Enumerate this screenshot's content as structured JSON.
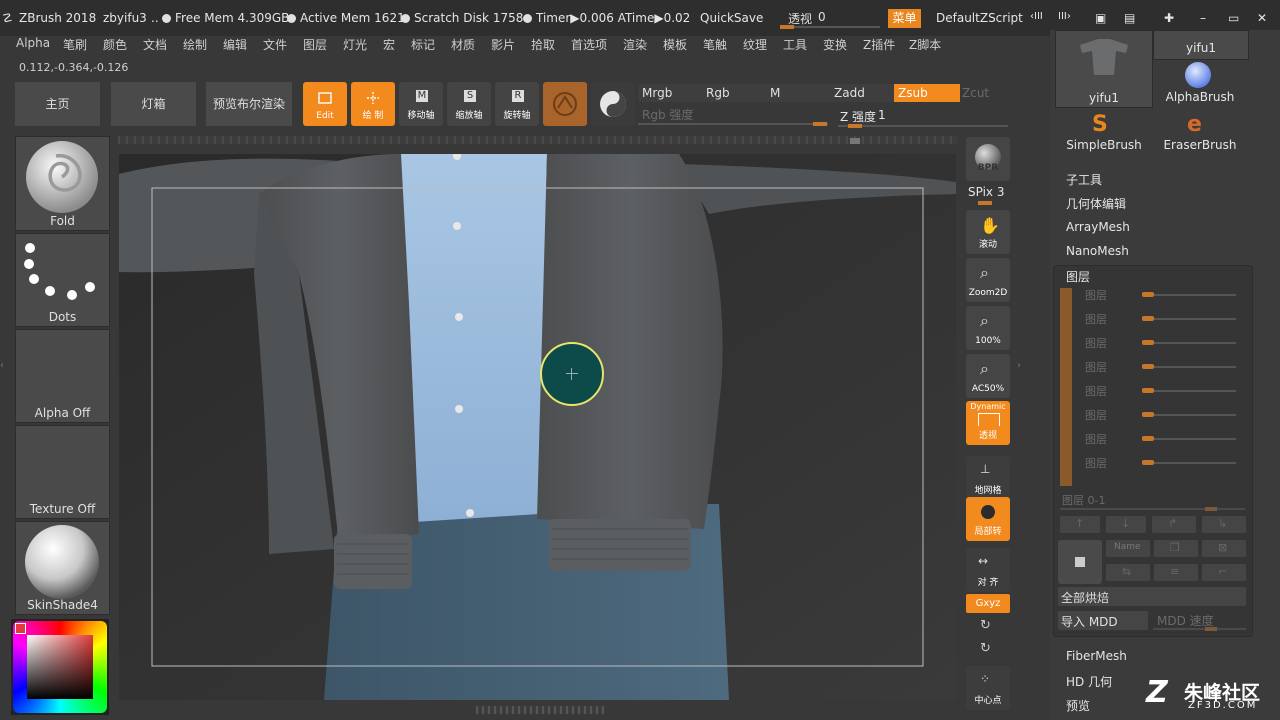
{
  "titlebar": {
    "app": "ZBrush 2018",
    "doc": "zbyifu3",
    "dots": "..",
    "free_mem": "Free Mem 4.309GB",
    "active_mem": "Active Mem 1621",
    "scratch": "Scratch Disk 1758",
    "timer": "Timer▶0.006 ATime▶0.02",
    "quicksave": "QuickSave",
    "perspective": "透视",
    "perspective_value": "0",
    "menu_label": "菜单",
    "script": "DefaultZScript"
  },
  "menus": [
    "Alpha",
    "笔刷",
    "颜色",
    "文档",
    "绘制",
    "编辑",
    "文件",
    "图层",
    "灯光",
    "宏",
    "标记",
    "材质",
    "影片",
    "拾取",
    "首选项",
    "渲染",
    "模板",
    "笔触",
    "纹理",
    "工具",
    "变换",
    "Z插件",
    "Z脚本"
  ],
  "coords": "0.112,-0.364,-0.126",
  "nav": {
    "home": "主页",
    "lightbox": "灯箱",
    "bpr_preview": "预览布尔渲染"
  },
  "tools": {
    "edit": "Edit",
    "draw": "绘 制",
    "move": "移动轴",
    "scale": "缩放轴",
    "rotate": "旋转轴"
  },
  "modes": {
    "mrgb": "Mrgb",
    "rgb": "Rgb",
    "m": "M",
    "zadd": "Zadd",
    "zsub": "Zsub",
    "zcut": "Zcut",
    "rgb_intensity": "Rgb 强度",
    "z_intensity": "Z 强度",
    "z_intensity_value": "1"
  },
  "left_shelf": {
    "brush": "Fold",
    "stroke": "Dots",
    "alpha": "Alpha Off",
    "texture": "Texture Off",
    "material": "SkinShade4"
  },
  "right_tools": {
    "bpr": "BPR",
    "spix": "SPix 3",
    "scroll": "滚动",
    "zoom2d": "Zoom2D",
    "zoom100": "100%",
    "ac50": "AC50%",
    "dynamic": "Dynamic",
    "persp": "透视",
    "floor": "地网格",
    "local": "局部转",
    "frame": "对 齐",
    "xyz": "Gxyz",
    "center": "中心点"
  },
  "right_panel": {
    "tool1": "yifu1",
    "tool2": "yifu1",
    "alphabrush": "AlphaBrush",
    "simplebrush": "SimpleBrush",
    "eraserbrush": "EraserBrush",
    "subtool": "子工具",
    "geometry": "几何体编辑",
    "arraymesh": "ArrayMesh",
    "nanomesh": "NanoMesh",
    "layers": "图层",
    "layer_rows": [
      "图层",
      "图层",
      "图层",
      "图层",
      "图层",
      "图层",
      "图层",
      "图层"
    ],
    "layer_range": "图层 0-1",
    "name_btn": "Name",
    "bake_all": "全部烘焙",
    "import_mdd": "导入 MDD",
    "mdd_speed": "MDD 速度",
    "fibermesh": "FiberMesh",
    "hd_geometry": "HD 几何",
    "preview": "预览"
  },
  "watermark": {
    "brand": "朱峰社区",
    "url": "ZF3D.COM"
  },
  "colors": {
    "accent": "#f28a1e",
    "background": "#383838",
    "cursor_fill": "#0d4a4a",
    "cursor_ring": "#e8e56a"
  }
}
